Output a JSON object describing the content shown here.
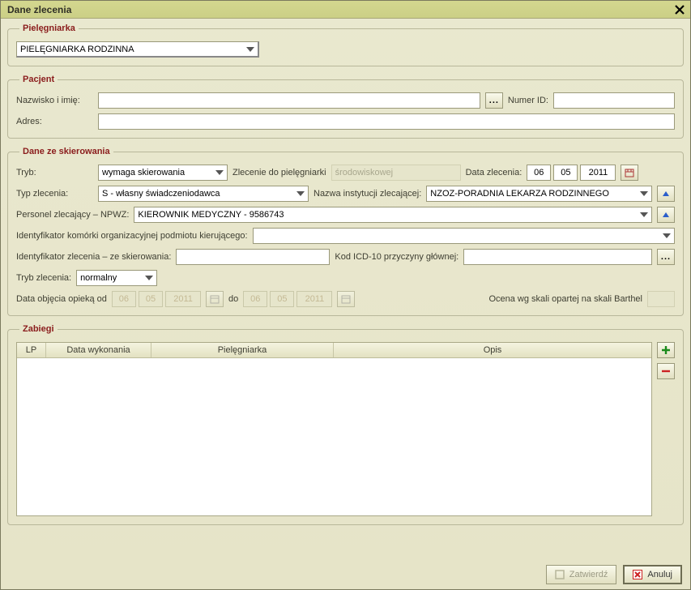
{
  "window": {
    "title": "Dane zlecenia"
  },
  "nurse": {
    "legend": "Pielęgniarka",
    "selected": "PIELĘGNIARKA RODZINNA"
  },
  "patient": {
    "legend": "Pacjent",
    "name_label": "Nazwisko i imię:",
    "name_value": "",
    "id_label": "Numer ID:",
    "id_value": "",
    "address_label": "Adres:",
    "address_value": ""
  },
  "referral": {
    "legend": "Dane ze skierowania",
    "tryb_label": "Tryb:",
    "tryb_value": "wymaga skierowania",
    "zlec_nurse_label": "Zlecenie do pielęgniarki",
    "zlec_nurse_value": "środowiskowej",
    "date_label": "Data zlecenia:",
    "date_d": "06",
    "date_m": "05",
    "date_y": "2011",
    "typ_label": "Typ zlecenia:",
    "typ_value": "S - własny świadczeniodawca",
    "inst_label": "Nazwa instytucji zlecającej:",
    "inst_value": "NZOZ-PORADNIA LEKARZA RODZINNEGO",
    "personel_label": "Personel zlecający – NPWZ:",
    "personel_value": "KIEROWNIK MEDYCZNY - 9586743",
    "idkom_label": "Identyfikator komórki organizacyjnej podmiotu kierującego:",
    "idkom_value": "",
    "idzlec_label": "Identyfikator zlecenia – ze skierowania:",
    "idzlec_value": "",
    "icd_label": "Kod ICD-10 przyczyny głównej:",
    "icd_value": "",
    "tryb2_label": "Tryb zlecenia:",
    "tryb2_value": "normalny",
    "opieka_label": "Data objęcia opieką od",
    "opieka_from_d": "06",
    "opieka_from_m": "05",
    "opieka_from_y": "2011",
    "do_label": "do",
    "opieka_to_d": "06",
    "opieka_to_m": "05",
    "opieka_to_y": "2011",
    "barthel_label": "Ocena wg skali opartej na skali Barthel",
    "barthel_value": ""
  },
  "zabiegi": {
    "legend": "Zabiegi",
    "columns": {
      "lp": "LP",
      "date": "Data wykonania",
      "nurse": "Pielęgniarka",
      "opis": "Opis"
    },
    "rows": []
  },
  "footer": {
    "confirm": "Zatwierdź",
    "cancel": "Anuluj"
  }
}
